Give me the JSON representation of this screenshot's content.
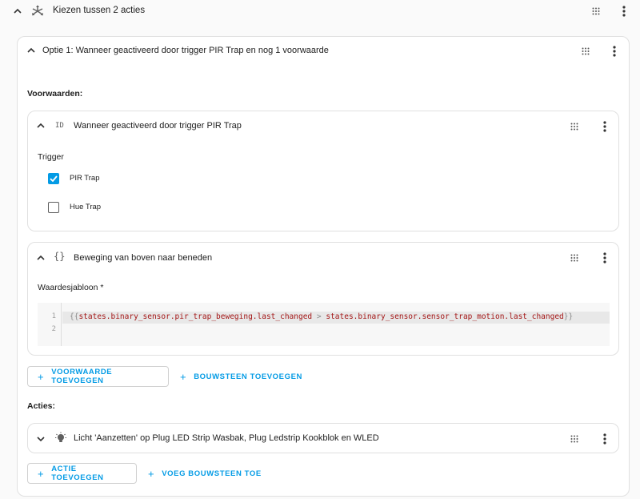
{
  "outer": {
    "title": "Kiezen tussen 2 acties",
    "icon": "arrows-split-icon"
  },
  "option": {
    "title": "Optie 1: Wanneer geactiveerd door trigger PIR Trap en nog 1 voorwaarde",
    "conditions_label": "Voorwaarden:",
    "actions_label": "Acties:"
  },
  "condition_trigger": {
    "icon_text": "ID",
    "title": "Wanneer geactiveerd door trigger PIR Trap",
    "field_label": "Trigger",
    "options": [
      {
        "label": "PIR Trap",
        "checked": true
      },
      {
        "label": "Hue Trap",
        "checked": false
      }
    ]
  },
  "condition_template": {
    "icon_text": "{}",
    "title": "Beweging van boven naar beneden",
    "field_label": "Waardesjabloon *",
    "lines": [
      "1",
      "2"
    ],
    "code_open": "{{",
    "code_left": "states.binary_sensor.pir_trap_beweging.last_changed",
    "code_op": ">",
    "code_right": "states.binary_sensor.sensor_trap_motion.last_changed",
    "code_close": "}}"
  },
  "condition_buttons": {
    "add_condition": "VOORWAARDE TOEVOEGEN",
    "add_block": "BOUWSTEEN TOEVOEGEN"
  },
  "action_item": {
    "icon": "lightbulb-icon",
    "title": "Licht 'Aanzetten' op Plug LED Strip Wasbak, Plug Ledstrip Kookblok en WLED"
  },
  "action_buttons": {
    "add_action": "ACTIE TOEVOEGEN",
    "add_block": "VOEG BOUWSTEEN TOE"
  },
  "colors": {
    "accent": "#039be5",
    "template": "#a31515"
  }
}
